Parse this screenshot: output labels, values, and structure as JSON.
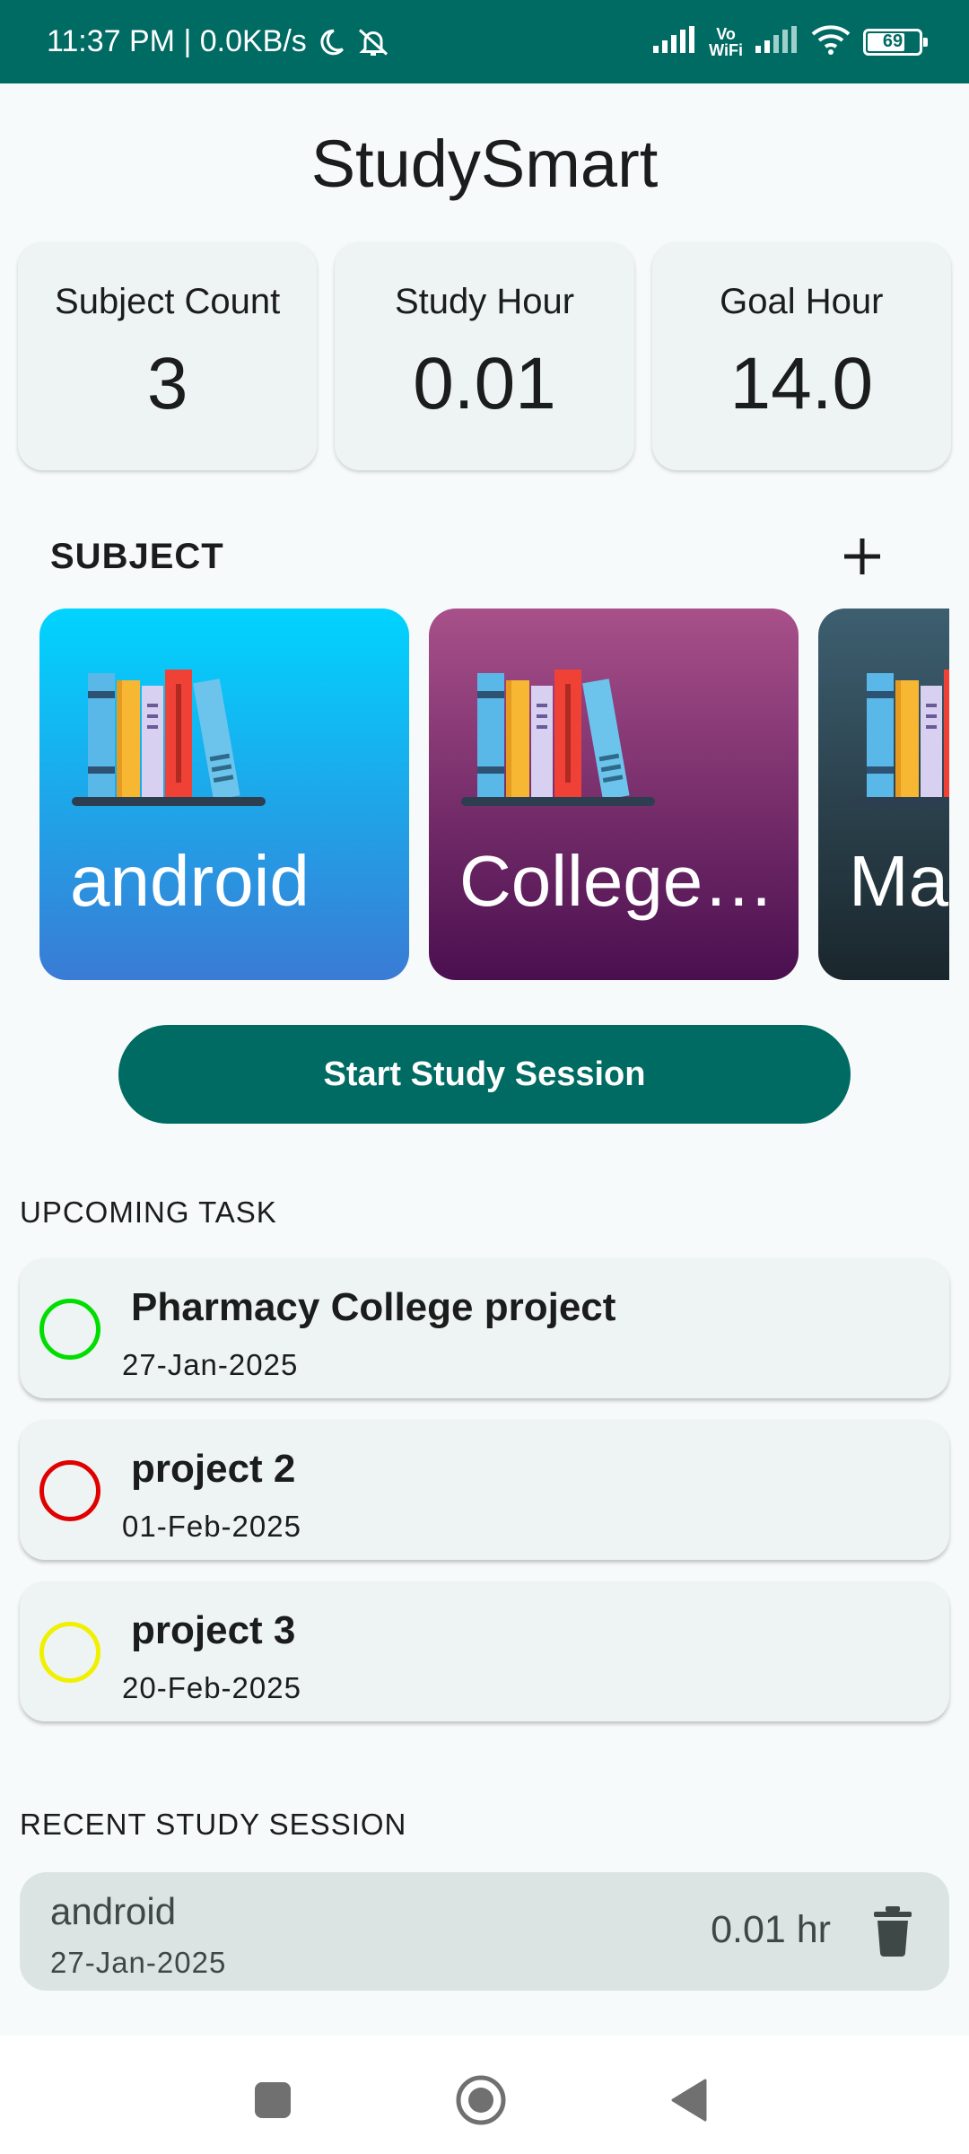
{
  "status_bar": {
    "time_speed": "11:37 PM | 0.0KB/s",
    "vowifi_top": "Vo",
    "vowifi_bottom": "WiFi",
    "battery": "69"
  },
  "app": {
    "title": "StudySmart"
  },
  "stats": [
    {
      "label": "Subject Count",
      "value": "3"
    },
    {
      "label": "Study Hour",
      "value": "0.01"
    },
    {
      "label": "Goal Hour",
      "value": "14.0"
    }
  ],
  "subjects_section": {
    "title": "SUBJECT",
    "items": [
      {
        "name": "android",
        "gradient": [
          "#00d4ff",
          "#3a7bd5"
        ]
      },
      {
        "name": "College…",
        "gradient": [
          "#a8508a",
          "#4a0f4f"
        ]
      },
      {
        "name": "Ma",
        "gradient": [
          "#3d5f70",
          "#1a262c"
        ]
      }
    ]
  },
  "start_button": {
    "label": "Start Study Session"
  },
  "tasks_section": {
    "title": "UPCOMING TASK",
    "items": [
      {
        "title": "Pharmacy College project",
        "date": "27-Jan-2025",
        "color": "#00dd00"
      },
      {
        "title": "project 2",
        "date": "01-Feb-2025",
        "color": "#e00000"
      },
      {
        "title": "project 3",
        "date": "20-Feb-2025",
        "color": "#f0f000"
      }
    ]
  },
  "sessions_section": {
    "title": "RECENT STUDY SESSION",
    "items": [
      {
        "subject": "android",
        "date": "27-Jan-2025",
        "duration": "0.01 hr"
      }
    ]
  },
  "colors": {
    "primary": "#006b63",
    "card": "#eef4f3",
    "session_card": "#dbe4e3"
  }
}
